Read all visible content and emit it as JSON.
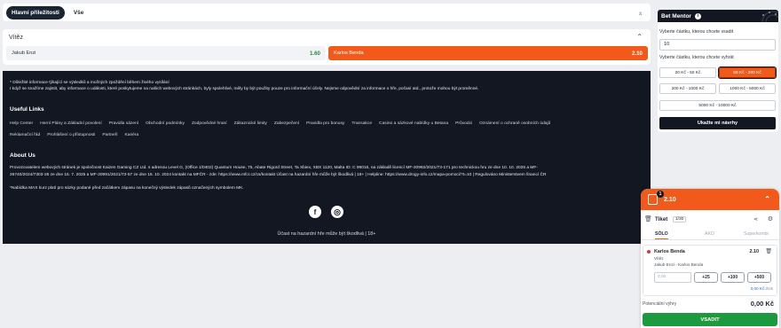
{
  "tabs": {
    "main": "Hlavní příležitosti",
    "all": "Vše",
    "collapse_icon": "collapse-all-icon"
  },
  "market": {
    "title": "Vítěz",
    "left": {
      "name": "Jakub Enzi",
      "odd": "1.60"
    },
    "right": {
      "name": "Karlos Benda",
      "odd": "2.10"
    }
  },
  "footer": {
    "note_1": "* Důležité informace týkající se výsledků a možných zpoždění během živého vysílání",
    "note_2": "I když se snažíme zajistit, aby informace o události, které poskytujeme na našich webových stránkách, byly spolehlivé, měly by být použity pouze pro informační účely. Nejsme odpovědní za informace o hře, počasí atd., protože mohou být proměnné.",
    "useful_links_title": "Useful Links",
    "links": [
      "Help Center",
      "Herní Plány a Základní povolení",
      "Pravidla sázení",
      "Obchodní podmínky",
      "Zodpovědné hraní",
      "Zákaznické limity",
      "Zabezpečení",
      "Pravidla pro bonusy",
      "Transakce",
      "Casino a sázkové nabídky u Betana",
      "Průvodci",
      "Oznámení o ochraně osobních údajů",
      "Reklamační řád",
      "Prohlášení o přístupnosti",
      "Partneři",
      "Kariéra"
    ],
    "about_title": "About Us",
    "about_1": "Provozovatelem webových stránek je společnost Kaizen Gaming CZ Ltd. s adresou Level G, (Office 1/0402) Quantum House, 75, Abate Rigord Street, Ta Xbiex, XBX 1120, Malta ID: C 99016, na základě licencí MF-20992/2021/73-171 pro technickou hru ze dne 10. 10. 2025 a MF-",
    "about_2": "26740/2024/7303-26 ze dne 15. 7. 2025 a MF-20991/2021/73-57 ze dne 15. 10. 2024 kontakt na MFČR - zde: https://www.mfcr.cz/cs/kontakt Účast na hazardní hře může být škodlivá | 18+ | Helpline: https://www.drogy-info.cz/mapa-pomoci/?t=10 | Regulováno Ministerstvem financí ČR",
    "max_note": "*Nabídka MAX kurz platí pro sázky podané před začátkem zápasu na konečný výsledek zápasů označených symbolem MK.",
    "facebook_glyph": "f",
    "instagram_glyph": "◎",
    "responsible": "Účast na hazardní hře může být škodlivá | 18+"
  },
  "mentor": {
    "title": "Bet Mentor",
    "info_glyph": "i",
    "stake_label": "Vyberte částku, kterou chcete vsadit",
    "stake_value": "10",
    "win_label": "Vyberte částku, kterou chcete vyhrát",
    "options": [
      "20 Kč - 50 Kč",
      "50 Kč - 200 Kč",
      "200 Kč - 1000 Kč",
      "1000 Kč - 5000 Kč",
      "5000 Kč - 10000 Kč"
    ],
    "selected_option": "50 Kč - 200 Kč",
    "show_button": "Ukažte mi návrhy"
  },
  "slip": {
    "count": "1",
    "total_odd": "2.10",
    "title": "Tiket",
    "tiket_count": "1/30",
    "tabs": [
      "SÓLO",
      "AKO",
      "Superkombi"
    ],
    "pick": {
      "name": "Karlos Benda",
      "odd": "2.10",
      "market": "Vítěz",
      "event": "Jakub Enzi - Karlos Benda",
      "stake_placeholder": "0,00",
      "quick_stakes": [
        "+25",
        "+100",
        "+500"
      ],
      "stake_sum": "0,00 Kč",
      "stake_suffix": "Zisk"
    },
    "potential_label": "Potenciální výhry",
    "potential_value": "0,00 Kč",
    "place_button": "VSADIT"
  },
  "colors": {
    "accent": "#f25a1b",
    "dark": "#121722",
    "green": "#1c9a3e",
    "background": "#eceef2"
  }
}
